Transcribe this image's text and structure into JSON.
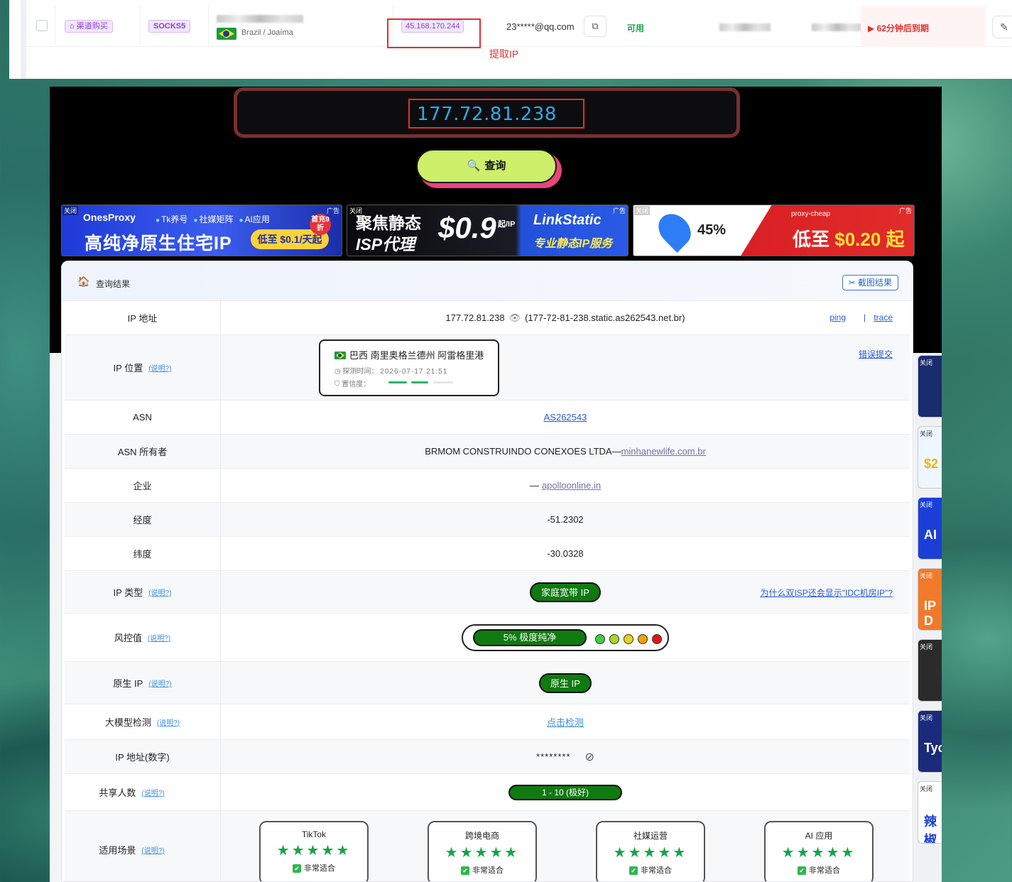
{
  "top": {
    "channel_tag": "渠道购买",
    "protocol_tag": "SOCKS5",
    "location": "Brazil / Joaíma",
    "ip": "45.168.170.244",
    "extract_label": "提取IP",
    "email": "23*****@qq.com",
    "status": "可用",
    "expire": "62分钟后到期"
  },
  "search": {
    "ip": "177.72.81.238",
    "button": "查询"
  },
  "ads": {
    "close": "关闭",
    "ad_tag": "广告",
    "ad1": {
      "brand": "OnesProxy",
      "chips": [
        "Tk养号",
        "社媒矩阵",
        "AI应用"
      ],
      "main": "高纯净原生住宅IP",
      "price": "低至 $0.1/天起",
      "badge": "首充9折"
    },
    "ad2": {
      "title1": "聚焦静态",
      "title2": "ISP代理",
      "price": "$0.9",
      "unit": "起/IP",
      "brand": "LinkStatic",
      "sub": "专业静态IP服务"
    },
    "ad3": {
      "pct": "45%",
      "brand": "proxy-cheap",
      "main_prefix": "低至",
      "main_price": "$0.20 起"
    }
  },
  "result": {
    "title": "查询结果",
    "screenshot_btn": "截图结果",
    "help": "(说明?)",
    "rows": {
      "ip": {
        "k": "IP 地址",
        "v": "177.72.81.238",
        "host": "(177-72-81-238.static.as262543.net.br)",
        "ping": "ping",
        "sep": "|",
        "trace": "trace"
      },
      "loc": {
        "k": "IP 位置",
        "place": "巴西 南里奥格兰德州 阿雷格里港",
        "time_label": "探测时间：",
        "time": "2026-07-17 21:51",
        "conf_label": "置信度：",
        "report": "错误提交",
        "confidence": 0.75
      },
      "asn": {
        "k": "ASN",
        "v": "AS262543"
      },
      "asn_owner": {
        "k": "ASN 所有者",
        "v": "BRMOM CONSTRUINDO CONEXOES LTDA—",
        "link": "minhanewlife.com.br"
      },
      "org": {
        "k": "企业",
        "v": "—",
        "link": "apolloonline.in"
      },
      "lon": {
        "k": "经度",
        "v": "-51.2302"
      },
      "lat": {
        "k": "纬度",
        "v": "-30.0328"
      },
      "type": {
        "k": "IP 类型",
        "v": "家庭宽带 IP",
        "note": "为什么双ISP还会显示\"IDC机房IP\"?"
      },
      "risk": {
        "k": "风控值",
        "v": "5%  极度纯净",
        "dots": [
          "#3fcf3f",
          "#a8d82e",
          "#e7d21a",
          "#f0a00e",
          "#e31515"
        ]
      },
      "native": {
        "k": "原生 IP",
        "v": "原生 IP"
      },
      "llm": {
        "k": "大模型检测",
        "v": "点击检测"
      },
      "num": {
        "k": "IP 地址(数字)",
        "v": "********"
      },
      "share": {
        "k": "共享人数",
        "v": "1 - 10 (极好)"
      },
      "scene": {
        "k": "适用场景",
        "items": [
          {
            "name": "TikTok",
            "stars": "★★★★★",
            "ok": "非常适合"
          },
          {
            "name": "跨境电商",
            "stars": "★★★★★",
            "ok": "非常适合"
          },
          {
            "name": "社媒运营",
            "stars": "★★★★★",
            "ok": "非常适合"
          },
          {
            "name": "AI 应用",
            "stars": "★★★★★",
            "ok": "非常适合"
          }
        ]
      }
    }
  },
  "side_ads": [
    {
      "big": "",
      "bg": "#1a2b6e"
    },
    {
      "big": "$2",
      "bg": "#eef6ff"
    },
    {
      "big": "AI",
      "bg": "#1b3fd6"
    },
    {
      "big": "IP D",
      "bg": "#f07a2b"
    },
    {
      "big": "",
      "bg": "#2b2b2b"
    },
    {
      "big": "Tycl",
      "bg": "#1b2a7a"
    },
    {
      "big": "辣椒",
      "bg": "#ffffff"
    }
  ]
}
